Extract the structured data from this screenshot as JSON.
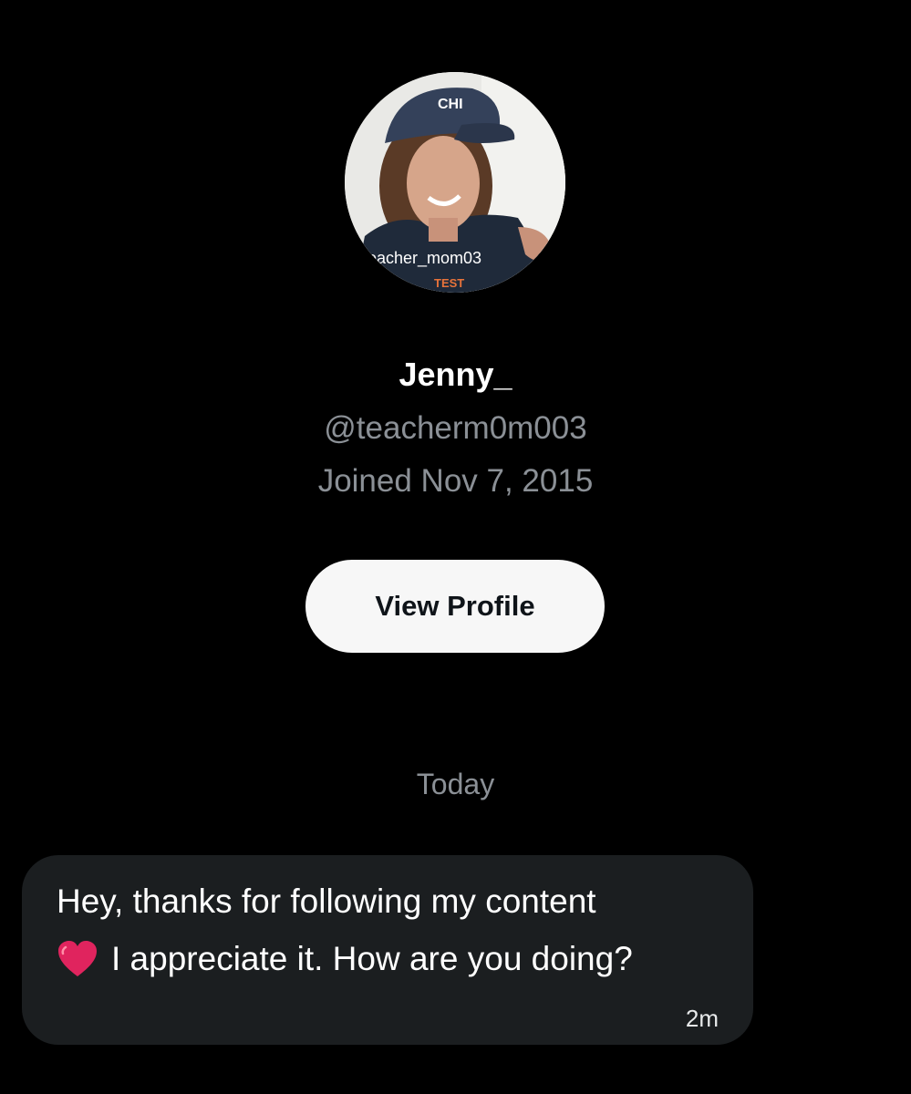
{
  "profile": {
    "avatar_alt": "teacher_mom03",
    "name": "Jenny_",
    "handle": "@teacherm0m003",
    "joined": "Joined Nov 7, 2015",
    "view_profile_label": "View Profile"
  },
  "conversation": {
    "date_separator": "Today",
    "messages": [
      {
        "line1": "Hey, thanks for following my content",
        "line2": "I appreciate it. How are you doing?",
        "emoji": "heart-icon",
        "time": "2m"
      }
    ]
  },
  "colors": {
    "background": "#000000",
    "bubble": "#1b1e20",
    "secondary_text": "#8b9096",
    "button_bg": "#f7f7f7",
    "heart": "#e0245e"
  }
}
